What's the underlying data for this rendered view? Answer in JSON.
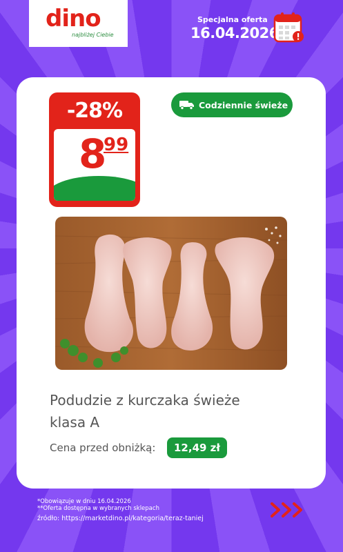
{
  "brand": {
    "name": "dino",
    "tagline": "najbliżej Ciebie",
    "color": "#e2231a"
  },
  "offer": {
    "label": "Specjalna oferta",
    "date": "16.04.2026"
  },
  "price_badge": {
    "discount": "-28%",
    "price_integer": "8",
    "price_decimal": "99"
  },
  "fresh_badge": {
    "label": "Codziennie świeże",
    "icon": "delivery-truck-icon"
  },
  "product": {
    "name_line1": "Podudzie z kurczaka świeże",
    "name_line2": "klasa A",
    "prev_price_label": "Cena przed obniżką:",
    "prev_price": "12,49 zł"
  },
  "footer": {
    "note1": "*Obowiązuje w dniu 16.04.2026",
    "note2": "**Oferta dostępna w wybranych sklepach",
    "source": "źródło: https://marketdino.pl/kategoria/teraz-taniej"
  },
  "colors": {
    "background": "#7b3ff2",
    "green": "#1a9a3c",
    "red": "#e2231a"
  }
}
